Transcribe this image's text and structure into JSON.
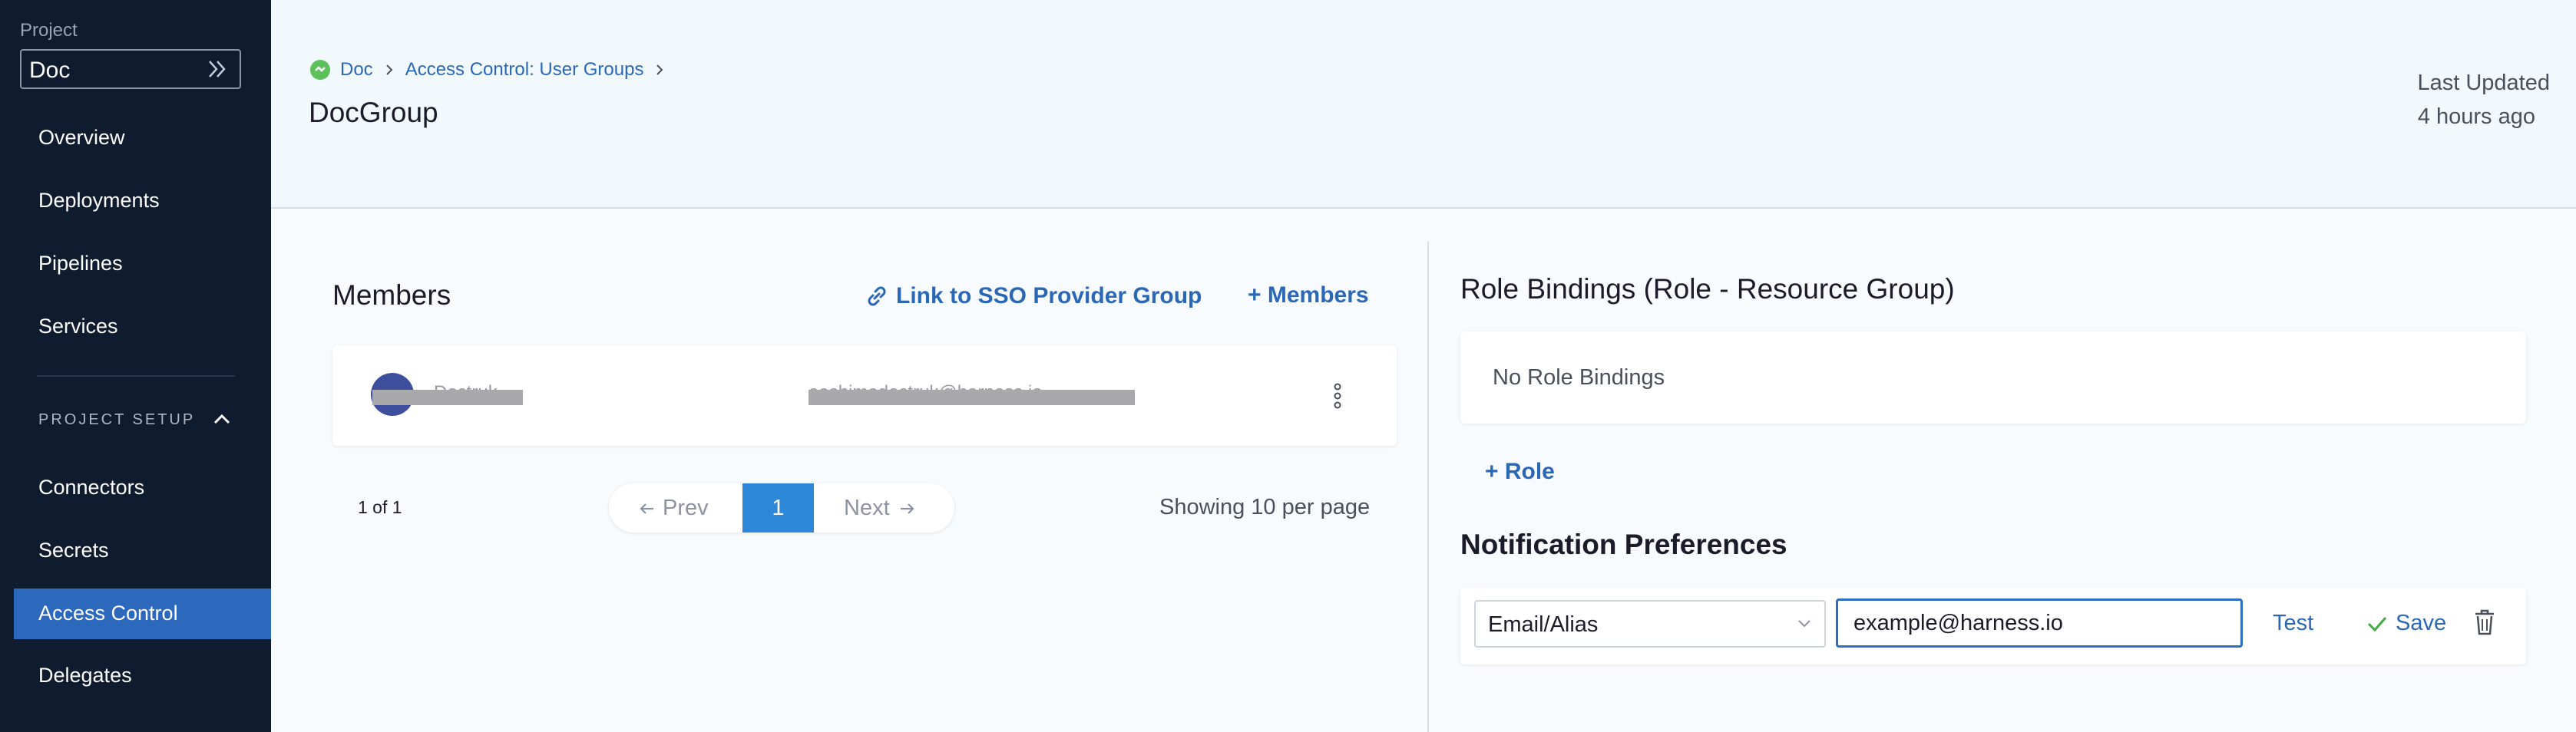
{
  "sidebar": {
    "project_label": "Project",
    "project_value": "Doc",
    "items": [
      {
        "label": "Overview"
      },
      {
        "label": "Deployments"
      },
      {
        "label": "Pipelines"
      },
      {
        "label": "Services"
      },
      {
        "label": "Connectors"
      },
      {
        "label": "Secrets"
      },
      {
        "label": "Access Control",
        "active": true
      },
      {
        "label": "Delegates"
      }
    ],
    "section_label": "PROJECT SETUP"
  },
  "header": {
    "breadcrumbs": [
      "Doc",
      "Access Control: User Groups"
    ],
    "title": "DocGroup",
    "last_updated_label": "Last Updated",
    "last_updated_value": "4 hours ago"
  },
  "members": {
    "title": "Members",
    "sso_link_label": "Link to SSO Provider Group",
    "add_members_label": "+ Members",
    "rows": [
      {
        "name": "Doctruk",
        "email": "aashimadoctruk@harness.io"
      }
    ],
    "pagination": {
      "count_text": "1 of 1",
      "prev_label": "Prev",
      "current_page": "1",
      "next_label": "Next",
      "per_page_text": "Showing 10 per page"
    }
  },
  "role_bindings": {
    "title": "Role Bindings (Role - Resource Group)",
    "empty_text": "No Role Bindings",
    "add_role_label": "+ Role"
  },
  "notifications": {
    "title": "Notification Preferences",
    "channel_value": "Email/Alias",
    "email_value": "example@harness.io",
    "test_label": "Test",
    "save_label": "Save"
  },
  "colors": {
    "sidebar_bg": "#0f1b2f",
    "active_nav": "#2c68bb",
    "accent": "#2a68b6",
    "pager_active": "#2d88d9"
  }
}
